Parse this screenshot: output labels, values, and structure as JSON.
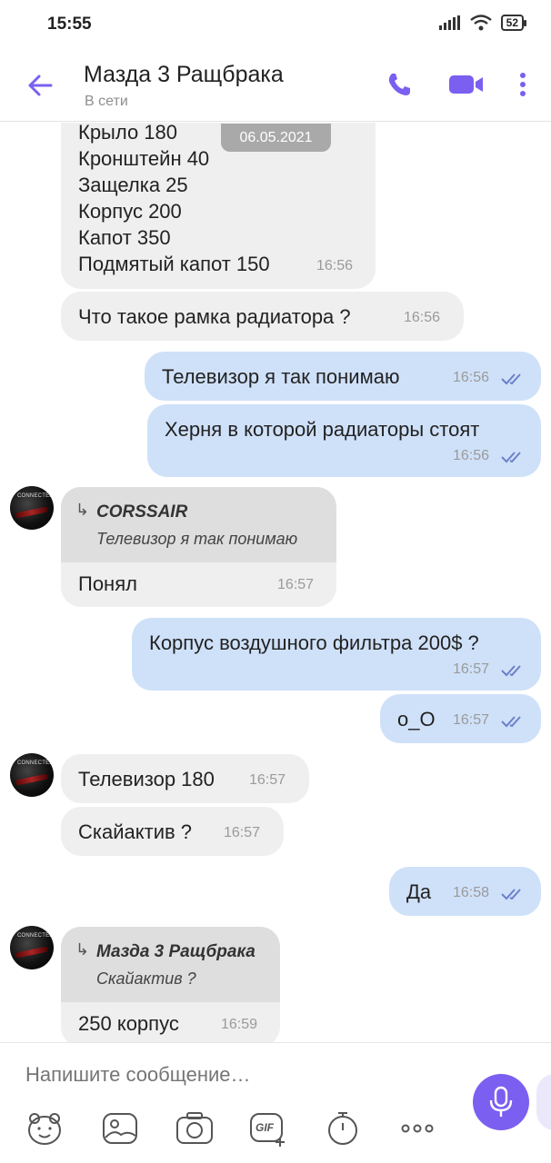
{
  "status_bar": {
    "time": "15:55",
    "battery": "52"
  },
  "header": {
    "title": "Мазда 3 Ращбрака",
    "subtitle": "В сети"
  },
  "date_chip": "06.05.2021",
  "messages": [
    {
      "dir": "in",
      "lines": [
        "Крыло 180",
        "Кронштейн 40",
        "Защелка 25",
        "Корпус 200",
        "Капот 350",
        "Подмятый капот 150"
      ],
      "time": "16:56"
    },
    {
      "dir": "in",
      "text": "Что такое рамка радиатора ?",
      "time": "16:56"
    },
    {
      "dir": "out",
      "text": "Телевизор я так понимаю",
      "time": "16:56"
    },
    {
      "dir": "out",
      "text": "Херня в которой радиаторы стоят",
      "time": "16:56"
    },
    {
      "dir": "in",
      "quote_name": "CORSSAIR",
      "quote_text": "Телевизор я так понимаю",
      "text": "Понял",
      "time": "16:57"
    },
    {
      "dir": "out",
      "text": "Корпус воздушного фильтра 200$ ?",
      "time": "16:57"
    },
    {
      "dir": "out",
      "text": "о_О",
      "time": "16:57"
    },
    {
      "dir": "in",
      "text": "Телевизор 180",
      "time": "16:57"
    },
    {
      "dir": "in",
      "text": "Скайактив ?",
      "time": "16:57"
    },
    {
      "dir": "out",
      "text": "Да",
      "time": "16:58"
    },
    {
      "dir": "in",
      "quote_name": "Мазда 3 Ращбрака",
      "quote_text": "Скайактив ?",
      "text": "250 корпус",
      "time": "16:59"
    }
  ],
  "avatar_label": "CONNECTED",
  "composer": {
    "placeholder": "Напишите сообщение…"
  },
  "toolbar": {
    "gif_label": "GIF"
  },
  "colors": {
    "accent": "#7b5ff0",
    "incoming": "#efefef",
    "outgoing": "#cfe1f9",
    "ticks": "#6c7fc9"
  },
  "icons": [
    "back-arrow-icon",
    "phone-icon",
    "video-icon",
    "more-vert-icon",
    "sticker-icon",
    "gallery-icon",
    "camera-icon",
    "gif-icon",
    "timer-icon",
    "more-horiz-icon",
    "mic-icon"
  ]
}
